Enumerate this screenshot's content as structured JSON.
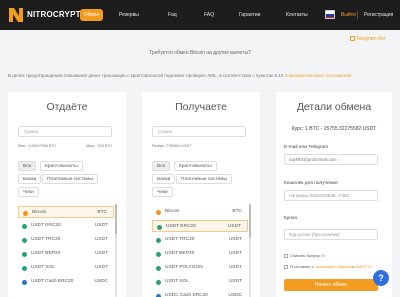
{
  "brand": {
    "name": "NITROCRYPT"
  },
  "nav": {
    "items": [
      {
        "label": "Обмен",
        "active": true
      },
      {
        "label": "Резервы",
        "active": false
      },
      {
        "label": "Faq",
        "active": false
      },
      {
        "label": "FAQ",
        "active": false
      },
      {
        "label": "Гарантии",
        "active": false
      },
      {
        "label": "Контакты",
        "active": false
      }
    ],
    "exit": "Выйти",
    "register": "Регистрация"
  },
  "info": {
    "telegram_support": "Telegram-бот",
    "promo": "Требуется обмен Bitcoin на другие валюты?",
    "notice": "В целях предотвращения отмывания денег транзакции с криптовалютой подлежит проверке AML, в соответствии с пунктом 9.10",
    "notice_link": "пользовательского соглашения"
  },
  "give": {
    "title": "Отдаёте",
    "amount_placeholder": "Сумма",
    "min": "Мин.: 0.00047508 BTC",
    "max": "Макс.: 200 BTC",
    "tabs": [
      "Все",
      "Криптовалюты",
      "Банки",
      "Платежные системы",
      "Чеки"
    ],
    "currencies": [
      {
        "name": "Bitcoin",
        "net": "BTC",
        "icon": "bitcoin-icon",
        "color": "#f7931a",
        "selected": true
      },
      {
        "name": "USDT ERC20",
        "net": "USDT",
        "icon": "tether-icon",
        "color": "#26a17b",
        "selected": false
      },
      {
        "name": "USDT TRC20",
        "net": "USDT",
        "icon": "tether-icon",
        "color": "#26a17b",
        "selected": false
      },
      {
        "name": "USDT BEP20",
        "net": "USDT",
        "icon": "tether-icon",
        "color": "#26a17b",
        "selected": false
      },
      {
        "name": "USDT SOL",
        "net": "USDT",
        "icon": "tether-icon",
        "color": "#26a17b",
        "selected": false
      },
      {
        "name": "USDT Cash ERC20",
        "net": "USDC",
        "icon": "usdc-icon",
        "color": "#2775ca",
        "selected": false
      }
    ]
  },
  "receive": {
    "title": "Получаете",
    "amount_placeholder": "Сумма",
    "reserve": "Резерв: 7790600 USDT",
    "tabs": [
      "Все",
      "Криптовалюты",
      "Банки",
      "Платежные системы",
      "Чеки"
    ],
    "currencies": [
      {
        "name": "Bitcoin",
        "net": "BTC",
        "icon": "bitcoin-icon",
        "color": "#f7931a",
        "selected": false
      },
      {
        "name": "USDT ERC20",
        "net": "USDT",
        "icon": "tether-icon",
        "color": "#26a17b",
        "selected": true
      },
      {
        "name": "USDT TRC20",
        "net": "USDT",
        "icon": "tether-icon",
        "color": "#26a17b",
        "selected": false
      },
      {
        "name": "USDT BEP20",
        "net": "USDT",
        "icon": "tether-icon",
        "color": "#26a17b",
        "selected": false
      },
      {
        "name": "USDT POLYGON",
        "net": "USDT",
        "icon": "tether-icon",
        "color": "#26a17b",
        "selected": false
      },
      {
        "name": "USDT SOL",
        "net": "USDT",
        "icon": "tether-icon",
        "color": "#26a17b",
        "selected": false
      },
      {
        "name": "USDC Cash ERC20",
        "net": "USDC",
        "icon": "usdc-icon",
        "color": "#2775ca",
        "selected": false
      }
    ]
  },
  "details": {
    "title": "Детали обмена",
    "rate": "Курс: 1 BTC - 25755.32275582 USDT",
    "email_label": "E-mail или Telegram",
    "email_value": "sophths@protonmail.com",
    "wallet_label": "Кошелёк для получения",
    "wallet_placeholder": "Например 0xEE2D6B3B...F3BC",
    "coupon_label": "Купон",
    "coupon_placeholder": "Код купона (При наличии)",
    "bonus_label": "Списать бонусы: 0",
    "agree_text": "Я согласен с",
    "agree_link": "правилами обмена",
    "agree_and": "и",
    "aml_link": "AML/KYC",
    "submit": "Начать обмен"
  },
  "colors": {
    "accent": "#f39c1f",
    "header_bg": "#1d1d1d",
    "help_button": "#2f6fe0"
  }
}
